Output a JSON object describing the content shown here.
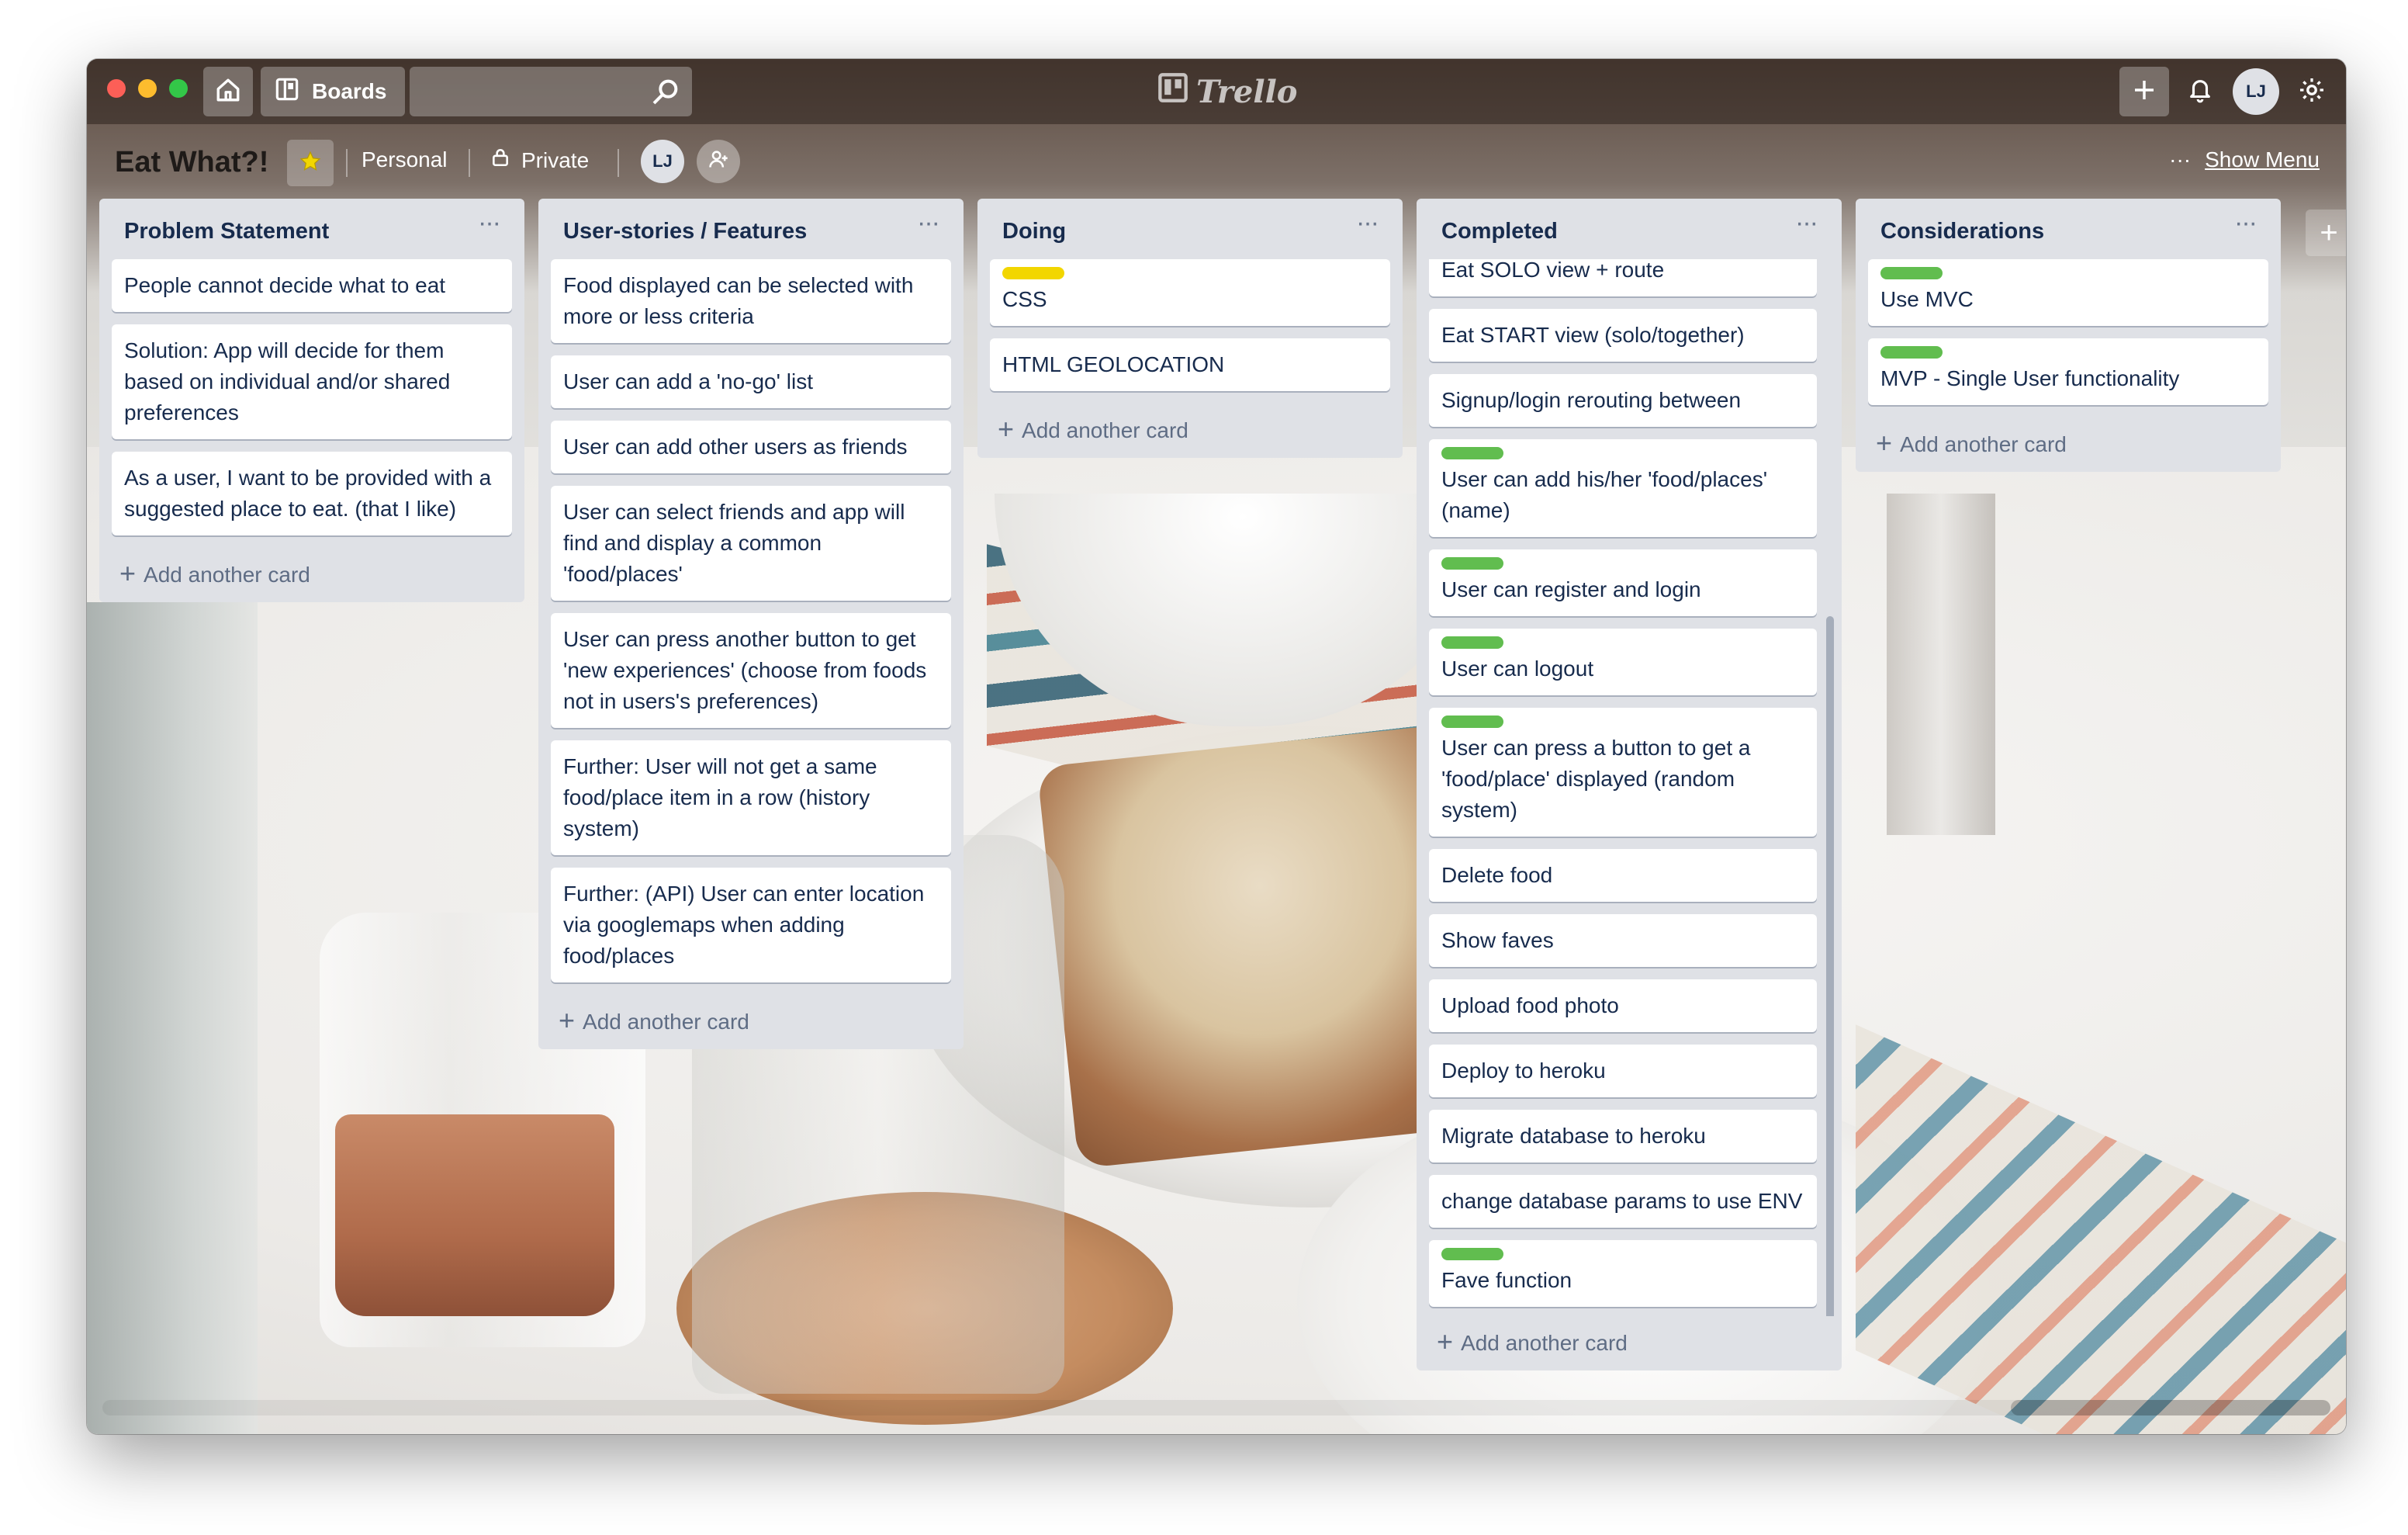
{
  "app": {
    "boards_label": "Boards",
    "logo_text": "Trello",
    "user_initials": "LJ"
  },
  "board": {
    "title": "Eat What?!",
    "team": "Personal",
    "visibility": "Private",
    "member_initials": "LJ",
    "show_menu": "Show Menu"
  },
  "colors": {
    "label_green": "#61bd4f",
    "label_yellow": "#f2d600",
    "list_bg": "#dfe1e6",
    "text": "#172b4d"
  },
  "add_card_label": "Add another card",
  "lists": [
    {
      "title": "Problem Statement",
      "cards": [
        {
          "text": "People cannot decide what to eat"
        },
        {
          "text": "Solution: App will decide for them based on individual and/or shared preferences"
        },
        {
          "text": "As a user, I want to be provided with a suggested place to eat. (that I like)"
        }
      ]
    },
    {
      "title": "User-stories / Features",
      "cards": [
        {
          "text": "Food displayed can be selected with more or less criteria"
        },
        {
          "text": "User can add a 'no-go' list"
        },
        {
          "text": "User can add other users as friends"
        },
        {
          "text": "User can select friends and app will find and display a common 'food/places'"
        },
        {
          "text": "User can press another button to get 'new experiences' (choose from foods not in users's preferences)"
        },
        {
          "text": "Further: User will not get a same food/place item in a row (history system)"
        },
        {
          "text": "Further: (API) User can enter location via googlemaps when adding food/places"
        }
      ]
    },
    {
      "title": "Doing",
      "cards": [
        {
          "text": "CSS",
          "label": "yellow"
        },
        {
          "text": "HTML GEOLOCATION"
        }
      ]
    },
    {
      "title": "Completed",
      "cards": [
        {
          "text": "Eat SOLO view + route"
        },
        {
          "text": "Eat START view (solo/together)"
        },
        {
          "text": "Signup/login rerouting between"
        },
        {
          "text": "User can add his/her 'food/places' (name)",
          "label": "green"
        },
        {
          "text": "User can register and login",
          "label": "green"
        },
        {
          "text": "User can logout",
          "label": "green"
        },
        {
          "text": "User can press a button to get a 'food/place' displayed (random system)",
          "label": "green"
        },
        {
          "text": "Delete food"
        },
        {
          "text": "Show faves"
        },
        {
          "text": "Upload food photo"
        },
        {
          "text": "Deploy to heroku"
        },
        {
          "text": "Migrate database to heroku"
        },
        {
          "text": "change database params to use ENV"
        },
        {
          "text": "Fave function",
          "label": "green"
        }
      ]
    },
    {
      "title": "Considerations",
      "cards": [
        {
          "text": "Use MVC",
          "label": "green"
        },
        {
          "text": "MVP - Single User functionality",
          "label": "green"
        }
      ]
    }
  ]
}
